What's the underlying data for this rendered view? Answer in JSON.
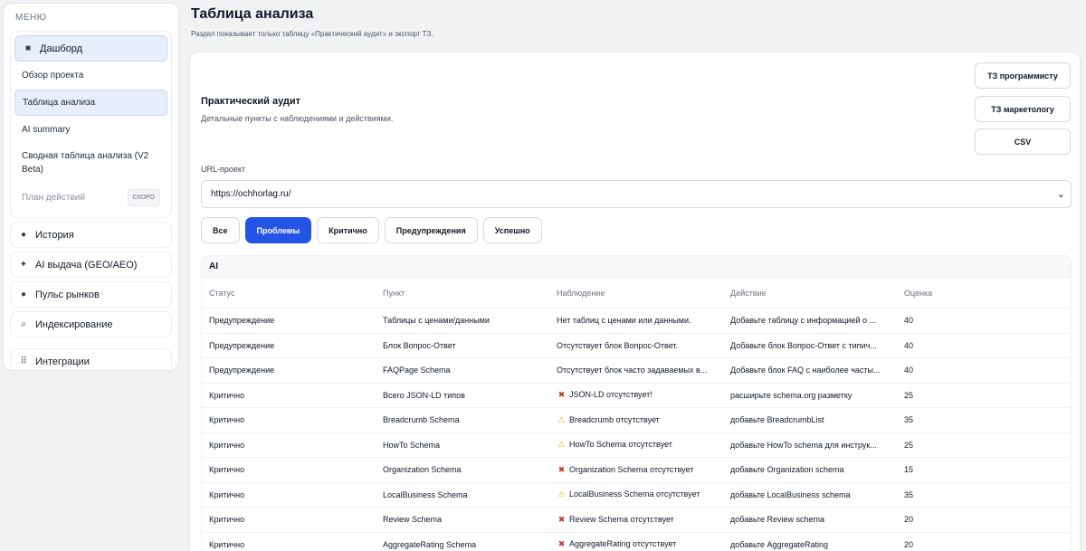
{
  "sidebar": {
    "menu_title": "МЕНЮ",
    "dashboard": {
      "label": "Дашборд",
      "items": [
        {
          "label": "Обзор проекта"
        },
        {
          "label": "Таблица анализа"
        },
        {
          "label": "AI summary"
        },
        {
          "label": "Сводная таблица анализа (V2 Beta)"
        },
        {
          "label": "План действий",
          "badge": "СКОРО"
        }
      ]
    },
    "history": "История",
    "ai_output": "AI выдача (GEO/AEO)",
    "market_pulse": "Пульс рынков",
    "indexing": "Индексирование",
    "integrations": "Интеграции"
  },
  "header": {
    "title": "Таблица анализа",
    "subtitle": "Раздел показывает только таблицу «Практический аудит» и экспорт ТЗ."
  },
  "section": {
    "title": "Практический аудит",
    "subtitle": "Детальные пункты с наблюдениями и действиями."
  },
  "export": {
    "developer": "ТЗ программисту",
    "marketer": "ТЗ маркетологу",
    "csv": "CSV"
  },
  "url": {
    "label": "URL-проект",
    "value": "https://ochhorlag.ru/"
  },
  "filters": [
    "Все",
    "Проблемы",
    "Критично",
    "Предупреждения",
    "Успешно"
  ],
  "active_filter": "Проблемы",
  "table": {
    "group": "AI",
    "columns": [
      "Статус",
      "Пункт",
      "Наблюдение",
      "Действие",
      "Оценка"
    ],
    "rows": [
      {
        "status": "Предупреждение",
        "item": "Таблицы с ценами/данными",
        "icon": "",
        "observation": "Нет таблиц с ценами или данными.",
        "action": "Добавьте таблицу с информацией о ...",
        "score": "40"
      },
      {
        "status": "Предупреждение",
        "item": "Блок Вопрос-Ответ",
        "icon": "",
        "observation": "Отсутствует блок Вопрос-Ответ.",
        "action": "Добавьте блок Вопрос-Ответ с типич...",
        "score": "40"
      },
      {
        "status": "Предупреждение",
        "item": "FAQPage Schema",
        "icon": "",
        "observation": "Отсутствует блок часто задаваемых в...",
        "action": "Добавьте блок FAQ с наиболее часты...",
        "score": "40"
      },
      {
        "status": "Критично",
        "item": "Всего JSON-LD типов",
        "icon": "x",
        "observation": "JSON-LD отсутствует!",
        "action": "расширьте schema.org разметку",
        "score": "25"
      },
      {
        "status": "Критично",
        "item": "Breadcrumb Schema",
        "icon": "warn",
        "observation": "Breadcrumb отсутствует",
        "action": "добавьте BreadcrumbList",
        "score": "35"
      },
      {
        "status": "Критично",
        "item": "HowTo Schema",
        "icon": "warn",
        "observation": "HowTo Schema отсутствует",
        "action": "добавьте HowTo schema для инструк...",
        "score": "25"
      },
      {
        "status": "Критично",
        "item": "Organization Schema",
        "icon": "x",
        "observation": "Organization Schema отсутствует",
        "action": "добавьте Organization schema",
        "score": "15"
      },
      {
        "status": "Критично",
        "item": "LocalBusiness Schema",
        "icon": "warn",
        "observation": "LocalBusiness Schema отсутствует",
        "action": "добавьте LocalBusiness schema",
        "score": "35"
      },
      {
        "status": "Критично",
        "item": "Review Schema",
        "icon": "x",
        "observation": "Review Schema отсутствует",
        "action": "добавьте Review schema",
        "score": "20"
      },
      {
        "status": "Критично",
        "item": "AggregateRating Schema",
        "icon": "x",
        "observation": "AggregateRating отсутствует",
        "action": "добавьте AggregateRating",
        "score": "20"
      }
    ]
  },
  "colors": {
    "accent": "#2454e6",
    "active_nav_bg": "#e8eefb",
    "error_icon": "#c0392b",
    "warning_icon": "#e6b800"
  }
}
